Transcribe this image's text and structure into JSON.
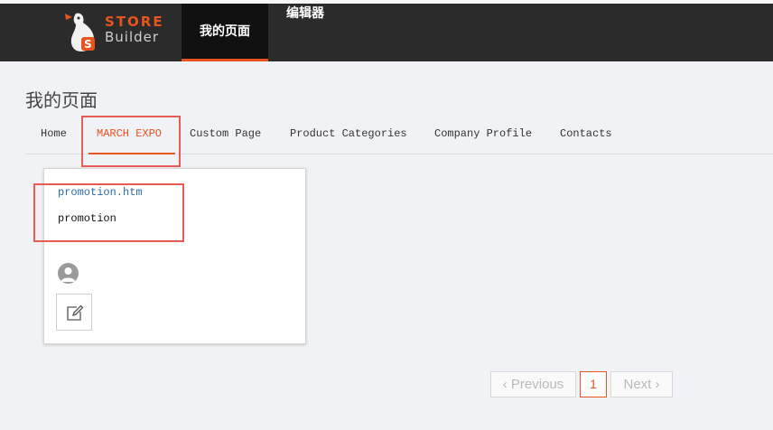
{
  "header": {
    "logo_store": "STORE",
    "logo_builder": "Builder",
    "nav": [
      {
        "label": "我的页面",
        "active": true
      },
      {
        "label": "编辑器",
        "active": false
      }
    ],
    "accent_color": "#e8531f"
  },
  "page_title": "我的页面",
  "tabs": [
    {
      "label": "Home"
    },
    {
      "label": "MARCH EXPO",
      "active": true
    },
    {
      "label": "Custom Page"
    },
    {
      "label": "Product Categories"
    },
    {
      "label": "Company Profile"
    },
    {
      "label": "Contacts"
    }
  ],
  "card": {
    "link": "promotion.htm",
    "name": "promotion",
    "avatar_icon": "user-icon",
    "edit_icon": "edit-icon"
  },
  "pagination": {
    "previous_label": "Previous",
    "current_page": "1",
    "next_label": "Next"
  }
}
